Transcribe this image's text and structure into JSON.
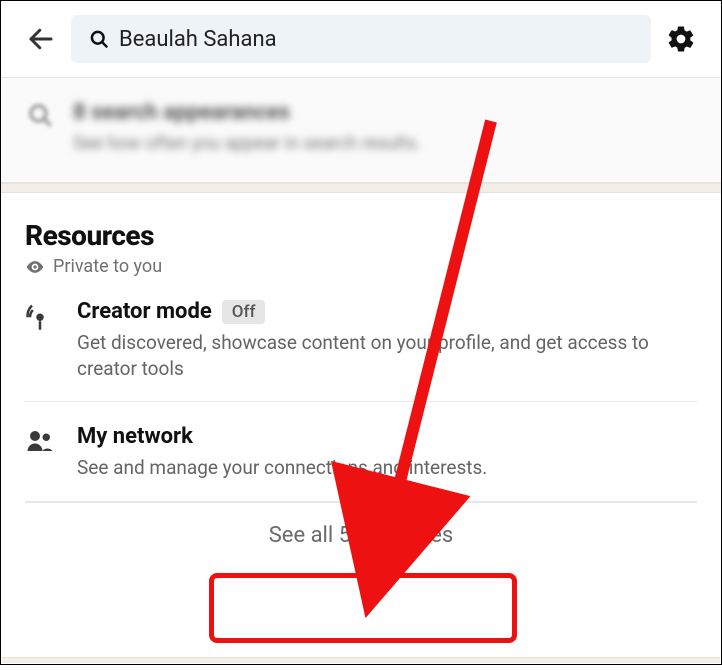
{
  "search": {
    "value": "Beaulah Sahana"
  },
  "blurred": {
    "line1": "8 search appearances",
    "line2": "See how often you appear in search results."
  },
  "resources": {
    "title": "Resources",
    "privacy_label": "Private to you",
    "items": [
      {
        "title": "Creator mode",
        "badge": "Off",
        "desc": "Get discovered, showcase content on your profile, and get access to creator tools"
      },
      {
        "title": "My network",
        "badge": null,
        "desc": "See and manage your connections and interests."
      }
    ],
    "see_all_label": "See all 5 resources"
  }
}
